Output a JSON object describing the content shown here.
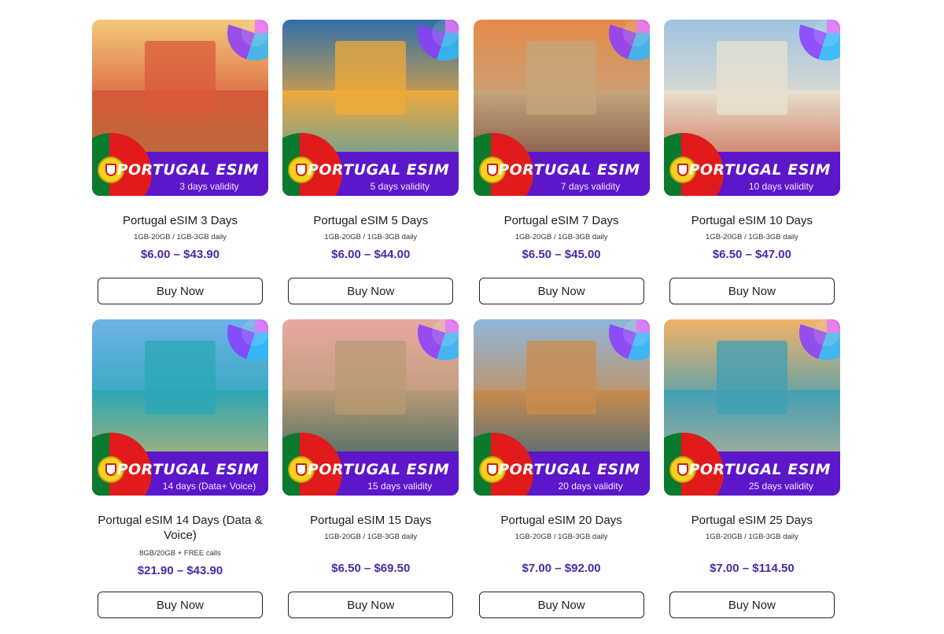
{
  "products": [
    {
      "banner_title": "PORTUGAL ESIM",
      "banner_sub": "3 days validity",
      "name": "Portugal eSIM 3 Days",
      "specs": "1GB-20GB / 1GB-3GB daily",
      "price": "$6.00 – $43.90",
      "button": "Buy Now",
      "scene": {
        "sky": "#f3c97a",
        "ground": "#a8733d",
        "feature": "#d85a3a"
      }
    },
    {
      "banner_title": "PORTUGAL ESIM",
      "banner_sub": "5 days validity",
      "name": "Portugal eSIM 5 Days",
      "specs": "1GB-20GB / 1GB-3GB daily",
      "price": "$6.00 – $44.00",
      "button": "Buy Now",
      "scene": {
        "sky": "#2f6fa8",
        "ground": "#2d9ec2",
        "feature": "#f0a93a"
      }
    },
    {
      "banner_title": "PORTUGAL ESIM",
      "banner_sub": "7 days validity",
      "name": "Portugal eSIM 7 Days",
      "specs": "1GB-20GB / 1GB-3GB daily",
      "price": "$6.50 – $45.00",
      "button": "Buy Now",
      "scene": {
        "sky": "#e58a4a",
        "ground": "#6b3b33",
        "feature": "#c4a57c"
      }
    },
    {
      "banner_title": "PORTUGAL ESIM",
      "banner_sub": "10 days validity",
      "name": "Portugal eSIM 10 Days",
      "specs": "1GB-20GB / 1GB-3GB daily",
      "price": "$6.50 – $47.00",
      "button": "Buy Now",
      "scene": {
        "sky": "#9fc3e0",
        "ground": "#c24b2e",
        "feature": "#e8e1d0"
      }
    },
    {
      "banner_title": "PORTUGAL ESIM",
      "banner_sub": "14 days (Data+ Voice)",
      "name": "Portugal eSIM 14 Days (Data & Voice)",
      "specs": "8GB/20GB + FREE calls",
      "price": "$21.90 – $43.90",
      "button": "Buy Now",
      "scene": {
        "sky": "#6fb2e8",
        "ground": "#e3b45f",
        "feature": "#2aa7b5"
      }
    },
    {
      "banner_title": "PORTUGAL ESIM",
      "banner_sub": "15 days validity",
      "name": "Portugal eSIM 15 Days",
      "specs": "1GB-20GB / 1GB-3GB daily",
      "price": "$6.50 – $69.50",
      "button": "Buy Now",
      "scene": {
        "sky": "#e7a9a1",
        "ground": "#1f5b64",
        "feature": "#b99a74"
      }
    },
    {
      "banner_title": "PORTUGAL ESIM",
      "banner_sub": "20 days validity",
      "name": "Portugal eSIM 20 Days",
      "specs": "1GB-20GB / 1GB-3GB daily",
      "price": "$7.00 – $92.00",
      "button": "Buy Now",
      "scene": {
        "sky": "#8fb6db",
        "ground": "#1f5f8a",
        "feature": "#c98c4e"
      }
    },
    {
      "banner_title": "PORTUGAL ESIM",
      "banner_sub": "25 days validity",
      "name": "Portugal eSIM 25 Days",
      "specs": "1GB-20GB / 1GB-3GB daily",
      "price": "$7.00 – $114.50",
      "button": "Buy Now",
      "scene": {
        "sky": "#f2b36a",
        "ground": "#d9b48a",
        "feature": "#3f9fb4"
      }
    }
  ]
}
